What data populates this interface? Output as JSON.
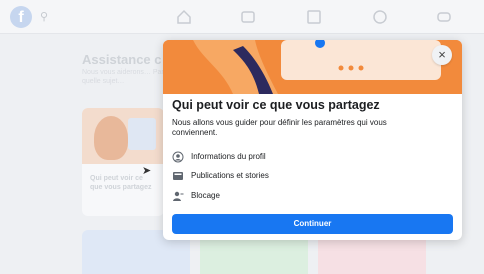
{
  "background": {
    "title": "Assistance c",
    "subtitle": "Nous vous aiderons… Par quelle sujet…",
    "card_label": "Qui peut voir ce que vous partagez"
  },
  "modal": {
    "title": "Qui peut voir ce que vous partagez",
    "description": "Nous allons vous guider pour définir les paramètres qui vous conviennent.",
    "items": [
      {
        "label": "Informations du profil",
        "icon": "profile-circle-icon"
      },
      {
        "label": "Publications et stories",
        "icon": "posts-icon"
      },
      {
        "label": "Blocage",
        "icon": "block-user-icon"
      }
    ],
    "continue_label": "Continuer",
    "close_icon": "×"
  },
  "colors": {
    "accent": "#1877f2",
    "banner": "#f28a3c"
  }
}
